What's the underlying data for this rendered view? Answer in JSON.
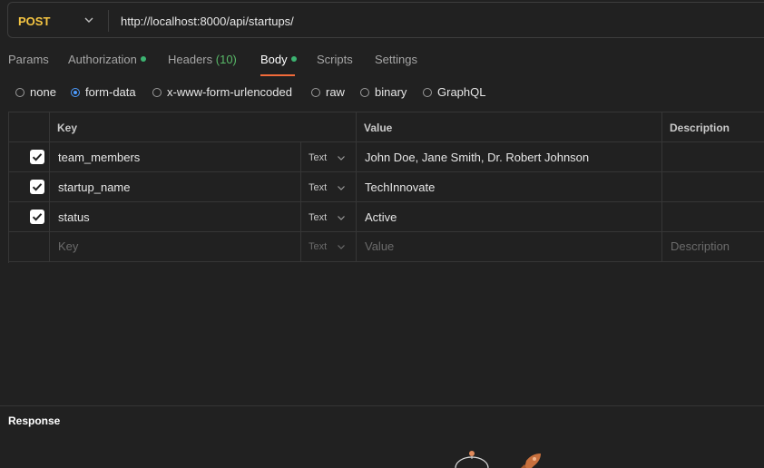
{
  "request": {
    "method": "POST",
    "url": "http://localhost:8000/api/startups/"
  },
  "tabs": [
    {
      "label": "Params"
    },
    {
      "label": "Authorization",
      "dot": true
    },
    {
      "label": "Headers",
      "count": "(10)"
    },
    {
      "label": "Body",
      "dot": true,
      "active": true
    },
    {
      "label": "Scripts"
    },
    {
      "label": "Settings"
    }
  ],
  "body_types": [
    {
      "label": "none",
      "selected": false
    },
    {
      "label": "form-data",
      "selected": true
    },
    {
      "label": "x-www-form-urlencoded",
      "selected": false
    },
    {
      "label": "raw",
      "selected": false
    },
    {
      "label": "binary",
      "selected": false
    },
    {
      "label": "GraphQL",
      "selected": false
    }
  ],
  "form_table": {
    "headers": {
      "key": "Key",
      "value": "Value",
      "description": "Description"
    },
    "rows": [
      {
        "checked": true,
        "key": "team_members",
        "type": "Text",
        "value": "John Doe, Jane Smith, Dr. Robert Johnson",
        "description": ""
      },
      {
        "checked": true,
        "key": "startup_name",
        "type": "Text",
        "value": "TechInnovate",
        "description": ""
      },
      {
        "checked": true,
        "key": "status",
        "type": "Text",
        "value": "Active",
        "description": ""
      }
    ],
    "placeholder_row": {
      "key": "Key",
      "type": "Text",
      "value": "Value",
      "description": "Description"
    }
  },
  "response": {
    "title": "Response"
  },
  "colors": {
    "accent": "#f26b3a",
    "method": "#f5c542",
    "checkbox": "#ffffff",
    "active_dot": "#3cb371"
  }
}
